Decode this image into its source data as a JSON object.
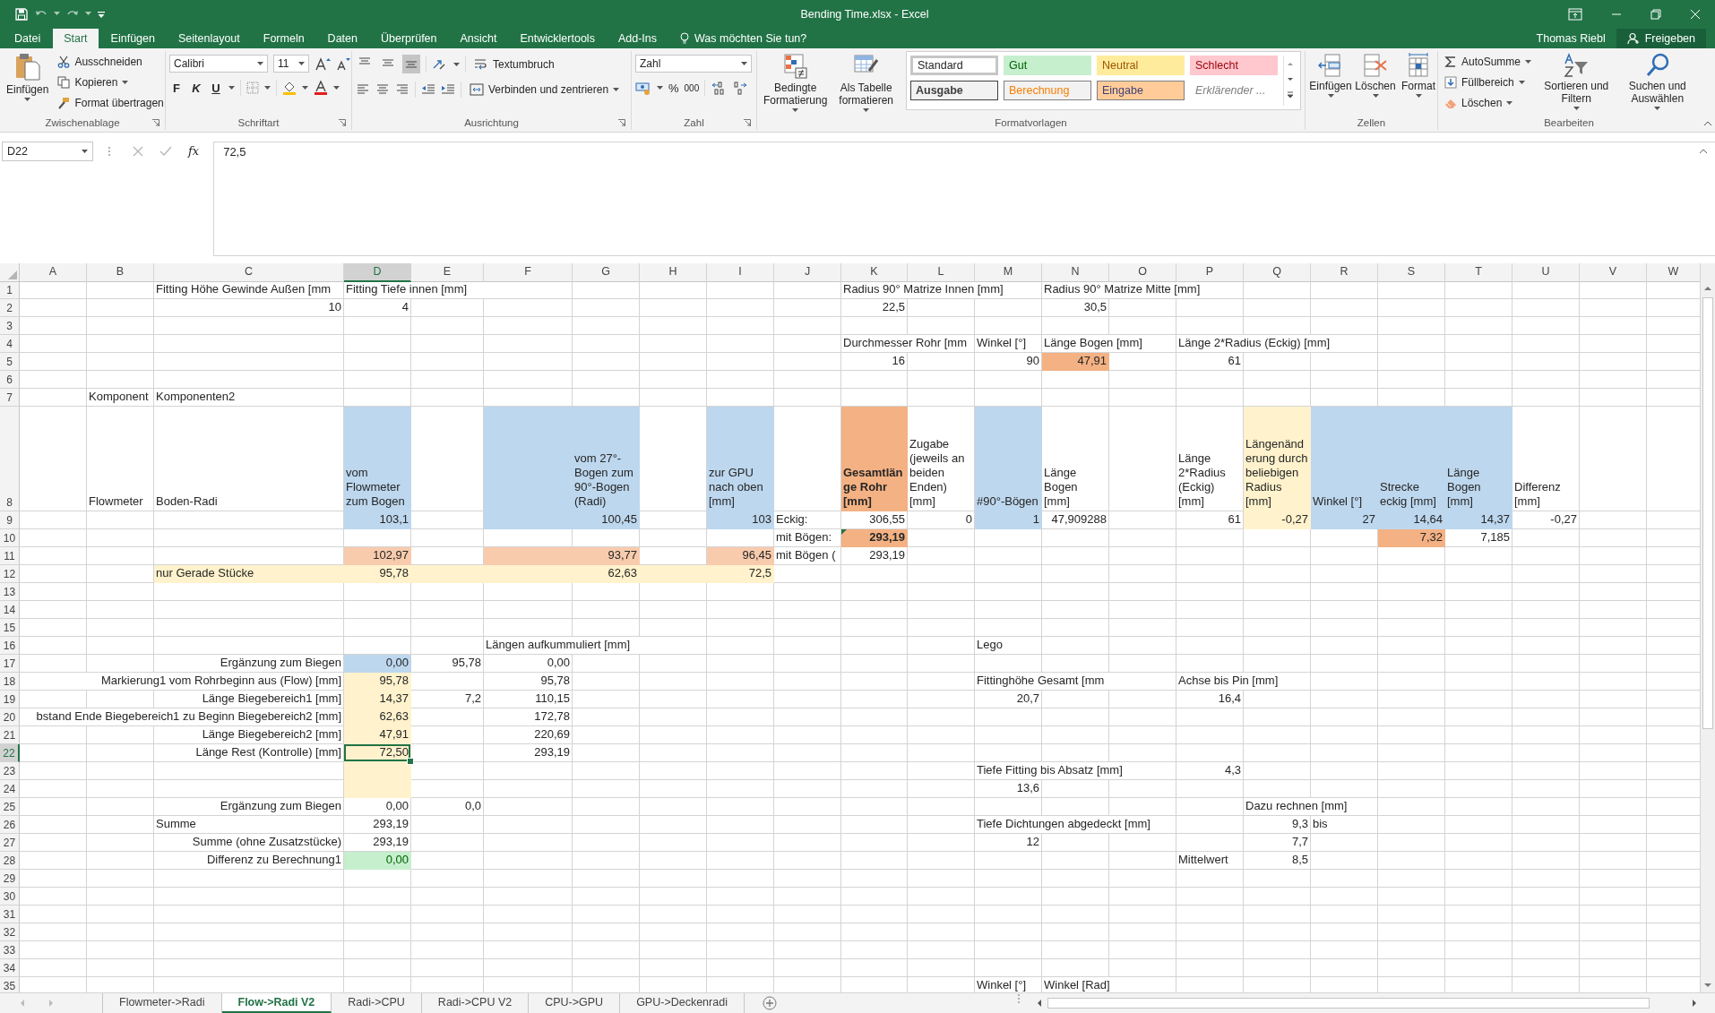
{
  "window": {
    "title": "Bending Time.xlsx - Excel",
    "user": "Thomas Riebl",
    "share_button": "Freigeben"
  },
  "menu_tabs": [
    {
      "label": "Datei",
      "selected": false
    },
    {
      "label": "Start",
      "selected": true
    },
    {
      "label": "Einfügen",
      "selected": false
    },
    {
      "label": "Seitenlayout",
      "selected": false
    },
    {
      "label": "Formeln",
      "selected": false
    },
    {
      "label": "Daten",
      "selected": false
    },
    {
      "label": "Überprüfen",
      "selected": false
    },
    {
      "label": "Ansicht",
      "selected": false
    },
    {
      "label": "Entwicklertools",
      "selected": false
    },
    {
      "label": "Add-Ins",
      "selected": false
    }
  ],
  "tell_me": "Was möchten Sie tun?",
  "ribbon": {
    "clipboard": {
      "label": "Zwischenablage",
      "paste": "Einfügen",
      "cut": "Ausschneiden",
      "copy": "Kopieren",
      "format_painter": "Format übertragen"
    },
    "font": {
      "label": "Schriftart",
      "family": "Calibri",
      "size": "11",
      "bold": "F",
      "italic": "K",
      "underline": "U"
    },
    "alignment": {
      "label": "Ausrichtung",
      "wrap_text": "Textumbruch",
      "merge": "Verbinden und zentrieren",
      "vertical_align": [
        {
          "selected": false
        },
        {
          "selected": false
        },
        {
          "selected": true
        }
      ]
    },
    "number": {
      "label": "Zahl",
      "format": "Zahl",
      "percent": "%",
      "thousands": "000"
    },
    "styles": {
      "label": "Formatvorlagen",
      "conditional": "Bedingte Formatierung",
      "as_table": "Als Tabelle formatieren",
      "gallery": [
        {
          "label": "Standard",
          "kind": "standard",
          "selected": true
        },
        {
          "label": "Gut",
          "kind": "good",
          "selected": false
        },
        {
          "label": "Neutral",
          "kind": "neutral",
          "selected": false
        },
        {
          "label": "Schlecht",
          "kind": "bad",
          "selected": false
        },
        {
          "label": "Ausgabe",
          "kind": "output",
          "selected": false
        },
        {
          "label": "Berechnung",
          "kind": "calculation",
          "selected": false
        },
        {
          "label": "Eingabe",
          "kind": "input",
          "selected": false
        },
        {
          "label": "Erklärender ...",
          "kind": "explanatory",
          "selected": false
        }
      ]
    },
    "cells": {
      "label": "Zellen",
      "insert": "Einfügen",
      "delete": "Löschen",
      "format": "Format"
    },
    "editing": {
      "label": "Bearbeiten",
      "autosum": "AutoSumme",
      "fill": "Füllbereich",
      "clear": "Löschen",
      "sort": "Sortieren und Filtern",
      "find": "Suchen und Auswählen"
    }
  },
  "formula_bar": {
    "name_box": "D22",
    "function_button": "fx",
    "value": "72,5"
  },
  "sheet": {
    "columns": [
      {
        "label": "A",
        "selected": false
      },
      {
        "label": "B",
        "selected": false
      },
      {
        "label": "C",
        "selected": false
      },
      {
        "label": "D",
        "selected": true
      },
      {
        "label": "E",
        "selected": false
      },
      {
        "label": "F",
        "selected": false
      },
      {
        "label": "G",
        "selected": false
      },
      {
        "label": "H",
        "selected": false
      },
      {
        "label": "I",
        "selected": false
      },
      {
        "label": "J",
        "selected": false
      },
      {
        "label": "K",
        "selected": false
      },
      {
        "label": "L",
        "selected": false
      },
      {
        "label": "M",
        "selected": false
      },
      {
        "label": "N",
        "selected": false
      },
      {
        "label": "O",
        "selected": false
      },
      {
        "label": "P",
        "selected": false
      },
      {
        "label": "Q",
        "selected": false
      },
      {
        "label": "R",
        "selected": false
      },
      {
        "label": "S",
        "selected": false
      },
      {
        "label": "T",
        "selected": false
      },
      {
        "label": "U",
        "selected": false
      },
      {
        "label": "V",
        "selected": false
      },
      {
        "label": "W",
        "selected": false
      }
    ],
    "rows": [
      {
        "header": "1",
        "selected": false,
        "cells": {
          "c": {
            "text": "Fitting Höhe Gewinde Außen [mm",
            "kind": "text"
          },
          "d": {
            "text": "Fitting Tiefe innen [mm]",
            "kind": "text"
          },
          "k": {
            "text": "Radius 90° Matrize Innen [mm]",
            "kind": "text"
          },
          "n": {
            "text": "Radius 90° Matrize Mitte [mm]",
            "kind": "text"
          }
        }
      },
      {
        "header": "2",
        "selected": false,
        "cells": {
          "c": {
            "text": "10",
            "kind": "number"
          },
          "d": {
            "text": "4",
            "kind": "number"
          },
          "k": {
            "text": "22,5",
            "kind": "number"
          },
          "n": {
            "text": "30,5",
            "kind": "number"
          }
        }
      },
      {
        "header": "3",
        "selected": false,
        "cells": {}
      },
      {
        "header": "4",
        "selected": false,
        "cells": {
          "k": {
            "text": "Durchmesser Rohr [mm",
            "kind": "text"
          },
          "m": {
            "text": "Winkel [°]",
            "kind": "text"
          },
          "n": {
            "text": "Länge Bogen [mm]",
            "kind": "text"
          },
          "p": {
            "text": "Länge 2*Radius (Eckig) [mm]",
            "kind": "text"
          }
        }
      },
      {
        "header": "5",
        "selected": false,
        "cells": {
          "k": {
            "text": "16",
            "kind": "number"
          },
          "m": {
            "text": "90",
            "kind": "number"
          },
          "n": {
            "text": "47,91",
            "kind": "number",
            "color": "#f4b183"
          },
          "p": {
            "text": "61",
            "kind": "number"
          }
        }
      },
      {
        "header": "6",
        "selected": false,
        "cells": {}
      },
      {
        "header": "7",
        "selected": false,
        "cells": {
          "b": {
            "text": "Komponent",
            "kind": "text"
          },
          "c": {
            "text": "Komponenten2",
            "kind": "text"
          }
        }
      },
      {
        "header": "8",
        "selected": false,
        "cells": {
          "b": {
            "text": "Flowmeter",
            "kind": "text"
          },
          "c": {
            "text": "Boden-Radi",
            "kind": "text"
          },
          "d": {
            "text": "vom Flowmeter zum Bogen",
            "kind": "wrap",
            "color": "#bdd7ee"
          },
          "f": {
            "color": "#bdd7ee"
          },
          "g": {
            "text": "vom 27°-Bogen zum 90°-Bogen (Radi)",
            "kind": "wrap",
            "color": "#bdd7ee"
          },
          "i": {
            "text": "zur GPU nach oben [mm]",
            "kind": "wrap",
            "color": "#bdd7ee"
          },
          "k": {
            "text": "Gesamtlänge Rohr [mm]",
            "kind": "wrap",
            "bold": true,
            "color": "#f4b183"
          },
          "l": {
            "text": "Zugabe (jeweils an beiden Enden) [mm]",
            "kind": "wrap"
          },
          "m": {
            "text": "#90°-Bögen",
            "kind": "wrap",
            "color": "#bdd7ee"
          },
          "n": {
            "text": "Länge Bogen [mm]",
            "kind": "wrap"
          },
          "p": {
            "text": "Länge 2*Radius (Eckig) [mm]",
            "kind": "wrap"
          },
          "q": {
            "text": "Längenänderung durch beliebigen Radius [mm]",
            "kind": "wrap",
            "color": "#fff2cc"
          },
          "r": {
            "text": "Winkel [°]",
            "kind": "wrap",
            "color": "#bdd7ee"
          },
          "s": {
            "text": "Strecke eckig [mm]",
            "kind": "wrap",
            "color": "#bdd7ee"
          },
          "t": {
            "text": "Länge Bogen [mm]",
            "kind": "wrap",
            "color": "#bdd7ee"
          },
          "u": {
            "text": "Differenz [mm]",
            "kind": "wrap"
          }
        }
      },
      {
        "header": "9",
        "selected": false,
        "cells": {
          "d": {
            "text": "103,1",
            "kind": "number",
            "color": "#bdd7ee"
          },
          "f": {
            "color": "#bdd7ee"
          },
          "g": {
            "text": "100,45",
            "kind": "number",
            "color": "#bdd7ee"
          },
          "i": {
            "text": "103",
            "kind": "number",
            "color": "#bdd7ee"
          },
          "j": {
            "text": "Eckig:",
            "kind": "text"
          },
          "k": {
            "text": "306,55",
            "kind": "number"
          },
          "l": {
            "text": "0",
            "kind": "number"
          },
          "m": {
            "text": "1",
            "kind": "number",
            "color": "#bdd7ee"
          },
          "n": {
            "text": "47,909288",
            "kind": "number"
          },
          "p": {
            "text": "61",
            "kind": "number"
          },
          "q": {
            "text": "-0,27",
            "kind": "number",
            "color": "#fff2cc"
          },
          "r": {
            "text": "27",
            "kind": "number",
            "color": "#bdd7ee"
          },
          "s": {
            "text": "14,64",
            "kind": "number",
            "color": "#bdd7ee"
          },
          "t": {
            "text": "14,37",
            "kind": "number",
            "color": "#bdd7ee"
          },
          "u": {
            "text": "-0,27",
            "kind": "number"
          }
        }
      },
      {
        "header": "10",
        "selected": false,
        "cells": {
          "j": {
            "text": "mit Bögen:",
            "kind": "text"
          },
          "k": {
            "text": "293,19",
            "kind": "number",
            "bold": true,
            "color": "#f4b183",
            "error_flag": true
          },
          "s": {
            "text": "7,32",
            "kind": "number",
            "color": "#f4b183"
          },
          "t": {
            "text": "7,185",
            "kind": "number"
          }
        }
      },
      {
        "header": "11",
        "selected": false,
        "cells": {
          "d": {
            "text": "102,97",
            "kind": "number",
            "color": "#f8cbad"
          },
          "f": {
            "color": "#f8cbad"
          },
          "g": {
            "text": "93,77",
            "kind": "number",
            "color": "#f8cbad"
          },
          "i": {
            "text": "96,45",
            "kind": "number",
            "color": "#f8cbad"
          },
          "j": {
            "text": "mit Bögen (",
            "kind": "text"
          },
          "k": {
            "text": "293,19",
            "kind": "number"
          }
        }
      },
      {
        "header": "12",
        "selected": false,
        "cells": {
          "c": {
            "text": "nur Gerade Stücke",
            "kind": "text",
            "color": "#fff2cc"
          },
          "d": {
            "text": "95,78",
            "kind": "number",
            "color": "#fff2cc"
          },
          "e": {
            "color": "#fff2cc"
          },
          "f": {
            "color": "#fff2cc"
          },
          "g": {
            "text": "62,63",
            "kind": "number",
            "color": "#fff2cc"
          },
          "h": {
            "color": "#fff2cc"
          },
          "i": {
            "text": "72,5",
            "kind": "number",
            "color": "#fff2cc"
          }
        }
      },
      {
        "header": "13",
        "selected": false,
        "cells": {}
      },
      {
        "header": "14",
        "selected": false,
        "cells": {}
      },
      {
        "header": "15",
        "selected": false,
        "cells": {}
      },
      {
        "header": "16",
        "selected": false,
        "cells": {
          "f": {
            "text": "Längen aufkummuliert [mm]",
            "kind": "text"
          },
          "m": {
            "text": "Lego",
            "kind": "text"
          }
        }
      },
      {
        "header": "17",
        "selected": false,
        "cells": {
          "c": {
            "text": "Ergänzung zum Biegen",
            "kind": "text_right"
          },
          "d": {
            "text": "0,00",
            "kind": "number",
            "color": "#bdd7ee"
          },
          "e": {
            "text": "95,78",
            "kind": "number"
          },
          "f": {
            "text": "0,00",
            "kind": "number"
          }
        }
      },
      {
        "header": "18",
        "selected": false,
        "cells": {
          "c": {
            "text": "Markierung1 vom Rohrbeginn aus (Flow) [mm]",
            "kind": "text_right"
          },
          "d": {
            "text": "95,78",
            "kind": "number",
            "color": "#fff2cc"
          },
          "f": {
            "text": "95,78",
            "kind": "number"
          },
          "m": {
            "text": "Fittinghöhe Gesamt [mm",
            "kind": "text"
          },
          "p": {
            "text": "Achse bis Pin [mm]",
            "kind": "text"
          }
        }
      },
      {
        "header": "19",
        "selected": false,
        "cells": {
          "c": {
            "text": "Länge Biegebereich1 [mm]",
            "kind": "text_right"
          },
          "d": {
            "text": "14,37",
            "kind": "number",
            "color": "#fff2cc"
          },
          "e": {
            "text": "7,2",
            "kind": "number"
          },
          "f": {
            "text": "110,15",
            "kind": "number"
          },
          "m": {
            "text": "20,7",
            "kind": "number"
          },
          "p": {
            "text": "16,4",
            "kind": "number"
          }
        }
      },
      {
        "header": "20",
        "selected": false,
        "cells": {
          "c": {
            "text": "bstand Ende Biegebereich1 zu Beginn Biegebereich2 [mm]",
            "kind": "text_right"
          },
          "d": {
            "text": "62,63",
            "kind": "number",
            "color": "#fff2cc"
          },
          "f": {
            "text": "172,78",
            "kind": "number"
          }
        }
      },
      {
        "header": "21",
        "selected": false,
        "cells": {
          "c": {
            "text": "Länge Biegebereich2 [mm]",
            "kind": "text_right"
          },
          "d": {
            "text": "47,91",
            "kind": "number",
            "color": "#fff2cc"
          },
          "f": {
            "text": "220,69",
            "kind": "number"
          }
        }
      },
      {
        "header": "22",
        "selected": true,
        "cells": {
          "c": {
            "text": "Länge Rest (Kontrolle) [mm]",
            "kind": "text_right"
          },
          "d": {
            "text": "72,50",
            "kind": "number",
            "color": "#fff2cc"
          },
          "f": {
            "text": "293,19",
            "kind": "number"
          }
        }
      },
      {
        "header": "23",
        "selected": false,
        "cells": {
          "d": {
            "color": "#fff2cc"
          },
          "m": {
            "text": "Tiefe Fitting bis Absatz [mm]",
            "kind": "text"
          },
          "p": {
            "text": "4,3",
            "kind": "number"
          }
        }
      },
      {
        "header": "24",
        "selected": false,
        "cells": {
          "d": {
            "color": "#fff2cc"
          },
          "m": {
            "text": "13,6",
            "kind": "number"
          }
        }
      },
      {
        "header": "25",
        "selected": false,
        "cells": {
          "c": {
            "text": "Ergänzung zum Biegen",
            "kind": "text_right"
          },
          "d": {
            "text": "0,00",
            "kind": "number"
          },
          "e": {
            "text": "0,0",
            "kind": "number"
          },
          "q": {
            "text": "Dazu rechnen [mm]",
            "kind": "text"
          }
        }
      },
      {
        "header": "26",
        "selected": false,
        "cells": {
          "c": {
            "text": "Summe",
            "kind": "text"
          },
          "d": {
            "text": "293,19",
            "kind": "number"
          },
          "m": {
            "text": "Tiefe Dichtungen abgedeckt [mm]",
            "kind": "text"
          },
          "q": {
            "text": "9,3",
            "kind": "number"
          },
          "r": {
            "text": "bis",
            "kind": "text"
          }
        }
      },
      {
        "header": "27",
        "selected": false,
        "cells": {
          "c": {
            "text": "Summe (ohne Zusatzstücke)",
            "kind": "text_right"
          },
          "d": {
            "text": "293,19",
            "kind": "number"
          },
          "m": {
            "text": "12",
            "kind": "number"
          },
          "q": {
            "text": "7,7",
            "kind": "number"
          }
        }
      },
      {
        "header": "28",
        "selected": false,
        "cells": {
          "c": {
            "text": "Differenz zu Berechnung1",
            "kind": "text_right"
          },
          "d": {
            "text": "0,00",
            "kind": "number",
            "color": "#c6efce",
            "good_style": true
          },
          "p": {
            "text": "Mittelwert",
            "kind": "text"
          },
          "q": {
            "text": "8,5",
            "kind": "number"
          }
        }
      },
      {
        "header": "29",
        "selected": false,
        "cells": {}
      },
      {
        "header": "30",
        "selected": false,
        "cells": {}
      },
      {
        "header": "31",
        "selected": false,
        "cells": {}
      },
      {
        "header": "32",
        "selected": false,
        "cells": {}
      },
      {
        "header": "33",
        "selected": false,
        "cells": {}
      },
      {
        "header": "34",
        "selected": false,
        "cells": {}
      },
      {
        "header": "35",
        "selected": false,
        "cells": {
          "m": {
            "text": "Winkel [°]",
            "kind": "text"
          },
          "n": {
            "text": "Winkel [Rad]",
            "kind": "text"
          }
        }
      }
    ]
  },
  "sheet_tabs": [
    {
      "label": "Flowmeter->Radi",
      "selected": false
    },
    {
      "label": "Flow->Radi V2",
      "selected": true
    },
    {
      "label": "Radi->CPU",
      "selected": false
    },
    {
      "label": "Radi->CPU V2",
      "selected": false
    },
    {
      "label": "CPU->GPU",
      "selected": false
    },
    {
      "label": "GPU->Deckenradi",
      "selected": false
    }
  ]
}
